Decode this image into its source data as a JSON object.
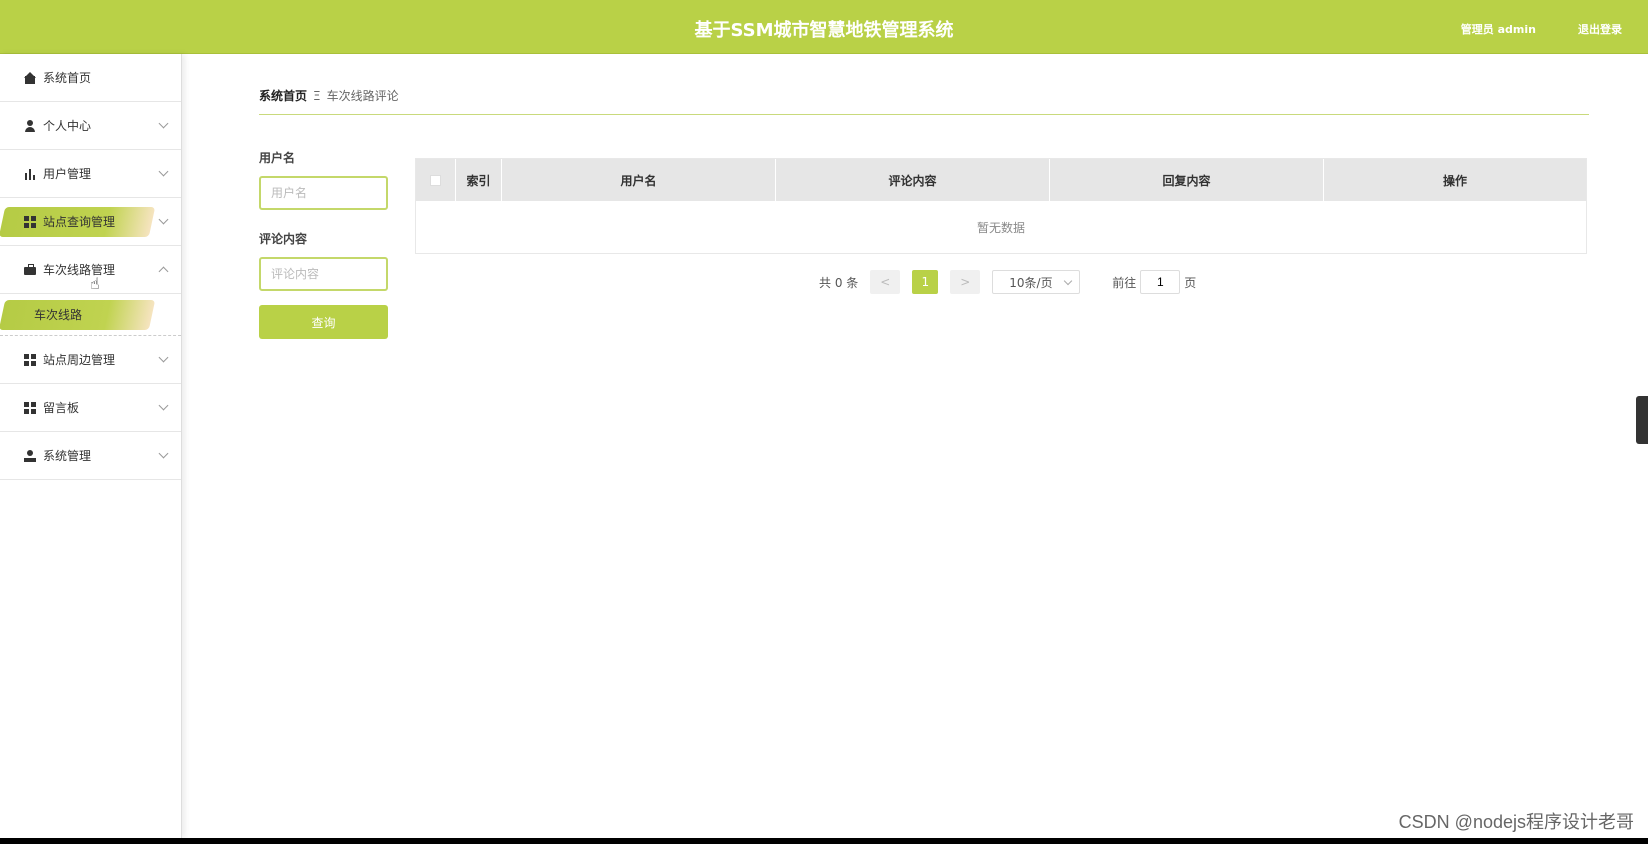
{
  "header": {
    "title": "基于SSM城市智慧地铁管理系统",
    "user_label": "管理员 admin",
    "logout_label": "退出登录"
  },
  "sidebar": {
    "items": [
      {
        "label": "系统首页",
        "icon": "home-icon"
      },
      {
        "label": "个人中心",
        "icon": "user-icon"
      },
      {
        "label": "用户管理",
        "icon": "bar-chart-icon"
      },
      {
        "label": "站点查询管理",
        "icon": "grid-icon"
      },
      {
        "label": "车次线路管理",
        "icon": "briefcase-icon"
      },
      {
        "label": "站点周边管理",
        "icon": "grid-icon"
      },
      {
        "label": "留言板",
        "icon": "grid-icon"
      },
      {
        "label": "系统管理",
        "icon": "admin-icon"
      }
    ],
    "submenu": {
      "label": "车次线路"
    }
  },
  "breadcrumb": {
    "home": "系统首页",
    "separator": "Ξ",
    "current": "车次线路评论"
  },
  "search": {
    "username_label": "用户名",
    "username_placeholder": "用户名",
    "comment_label": "评论内容",
    "comment_placeholder": "评论内容",
    "query_button": "查询"
  },
  "table": {
    "columns": [
      "索引",
      "用户名",
      "评论内容",
      "回复内容",
      "操作"
    ],
    "empty_text": "暂无数据"
  },
  "pagination": {
    "total_text": "共 0 条",
    "prev": "<",
    "current_page": "1",
    "next": ">",
    "page_size": "10条/页",
    "goto_label": "前往",
    "goto_value": "1",
    "page_suffix": "页"
  },
  "watermark": "CSDN @nodejs程序设计老哥",
  "colors": {
    "accent": "#b9d147"
  }
}
